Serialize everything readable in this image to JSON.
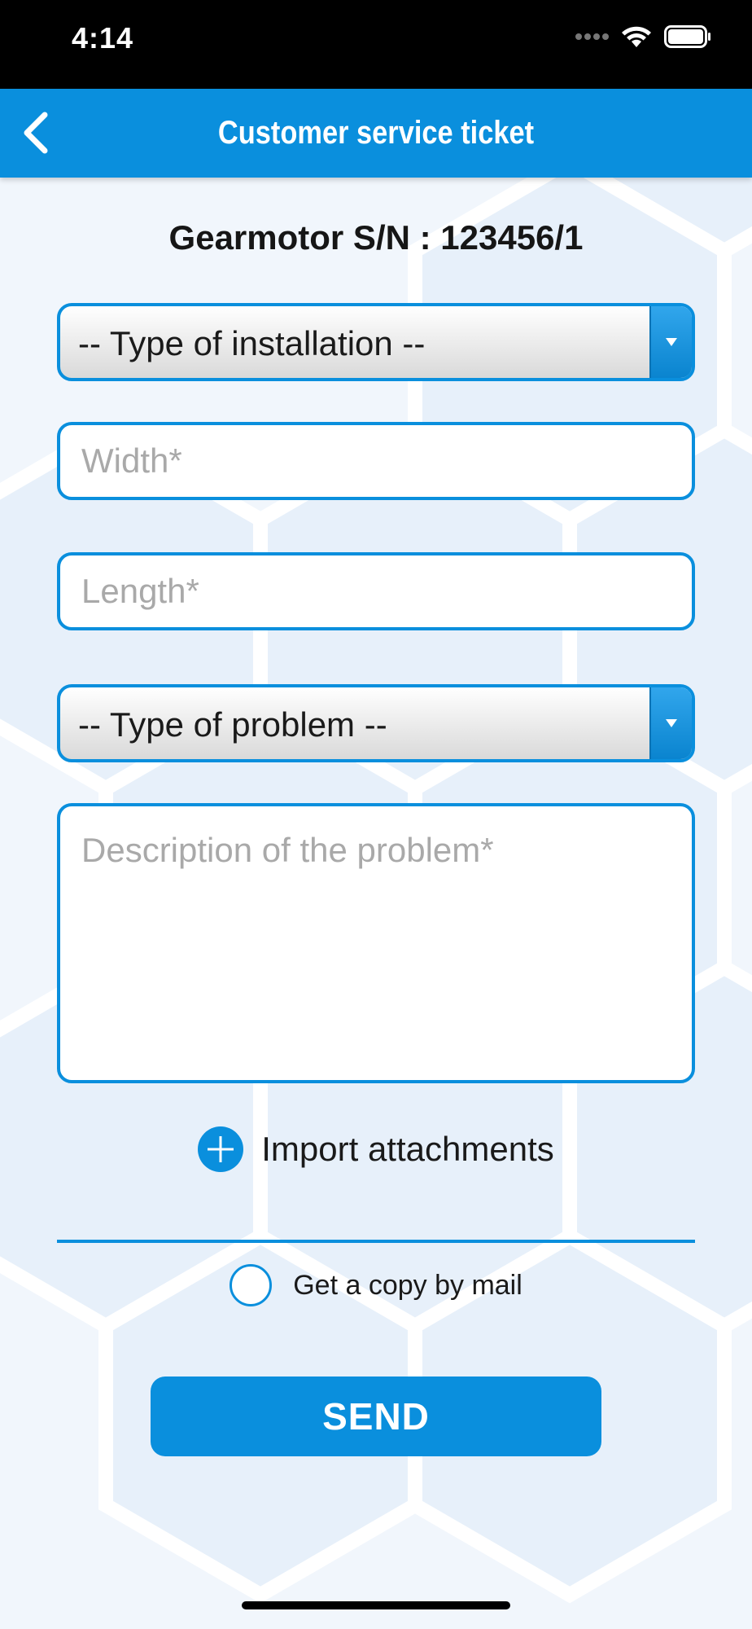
{
  "status_bar": {
    "time": "4:14"
  },
  "nav": {
    "title": "Customer service ticket",
    "back_icon": "chevron-left-icon"
  },
  "form": {
    "serial": "Gearmotor S/N : 123456/1",
    "installation_select": {
      "selected": "-- Type of installation --"
    },
    "width_field": {
      "placeholder": "Width*",
      "value": ""
    },
    "length_field": {
      "placeholder": "Length*",
      "value": ""
    },
    "problem_select": {
      "selected": "-- Type of problem --"
    },
    "description_field": {
      "placeholder": "Description of the problem*",
      "value": ""
    },
    "attachments_label": "Import attachments",
    "copy_by_mail": {
      "label": "Get a copy by mail",
      "checked": false
    },
    "send_label": "SEND"
  },
  "colors": {
    "accent": "#0a8fdd",
    "background": "#f1f6fc"
  }
}
